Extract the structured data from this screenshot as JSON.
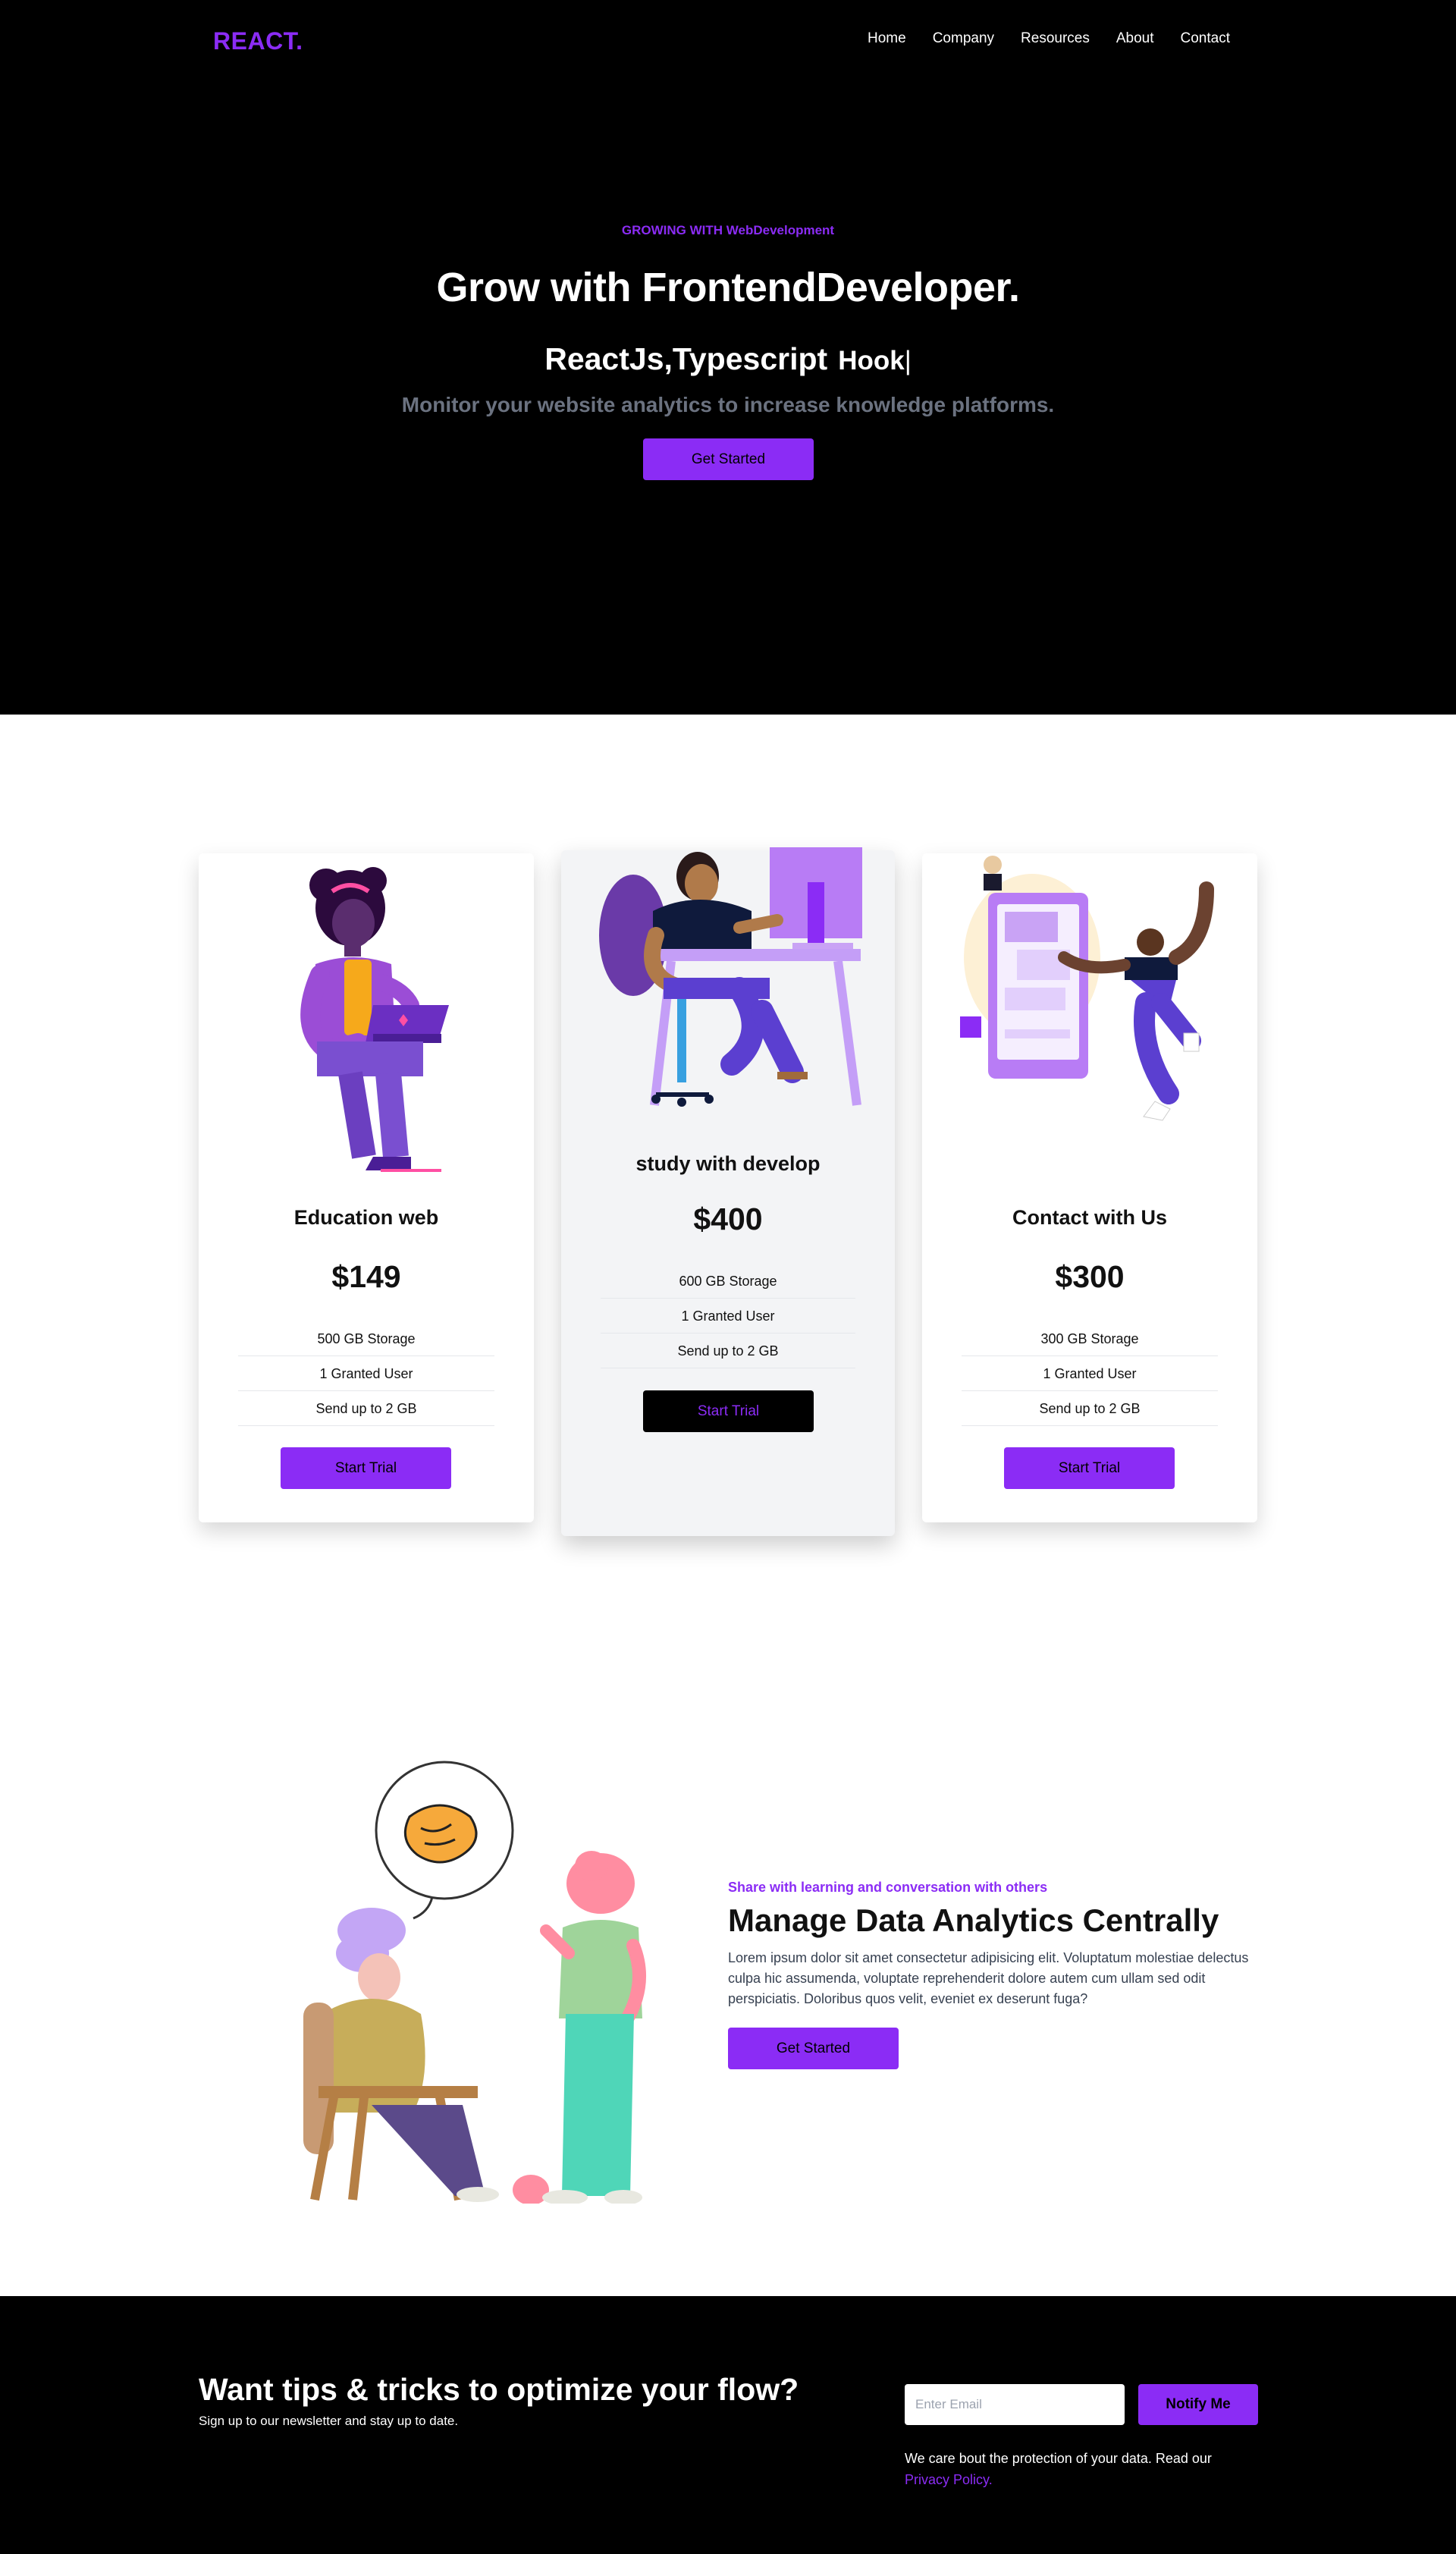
{
  "header": {
    "logo": "REACT.",
    "nav": [
      "Home",
      "Company",
      "Resources",
      "About",
      "Contact"
    ]
  },
  "hero": {
    "eyebrow": "GROWING WITH WebDevelopment",
    "title": "Grow with FrontendDeveloper.",
    "typed_static": "ReactJs,Typescript",
    "typed_word": "Hook",
    "cursor": "|",
    "subtitle": "Monitor your website analytics to increase knowledge platforms.",
    "cta": "Get Started"
  },
  "pricing": [
    {
      "name": "Education web",
      "price": "$149",
      "features": [
        "500 GB Storage",
        "1 Granted User",
        "Send up to 2 GB"
      ],
      "button": "Start Trial",
      "illustration": "woman-laptop-illustration"
    },
    {
      "name": "study with develop",
      "price": "$400",
      "features": [
        "600 GB Storage",
        "1 Granted User",
        "Send up to 2 GB"
      ],
      "button": "Start Trial",
      "illustration": "developer-desk-illustration"
    },
    {
      "name": "Contact with Us",
      "price": "$300",
      "features": [
        "300 GB Storage",
        "1 Granted User",
        "Send up to 2 GB"
      ],
      "button": "Start Trial",
      "illustration": "phone-chat-illustration"
    }
  ],
  "feature": {
    "eyebrow": "Share with learning and conversation with others",
    "title": "Manage Data Analytics Centrally",
    "body": "Lorem ipsum dolor sit amet consectetur adipisicing elit. Voluptatum molestiae delectus culpa hic assumenda, voluptate reprehenderit dolore autem cum ullam sed odit perspiciatis. Doloribus quos velit, eveniet ex deserunt fuga?",
    "cta": "Get Started",
    "illustration": "conversation-illustration"
  },
  "newsletter": {
    "title": "Want tips & tricks to optimize your flow?",
    "subtitle": "Sign up to our newsletter and stay up to date.",
    "input_placeholder": "Enter Email",
    "button": "Notify Me",
    "note": "We care bout the protection of your data. Read our",
    "link": "Privacy Policy."
  },
  "colors": {
    "accent": "#8b2cf5",
    "dark": "#000000",
    "muted": "#6b7280"
  }
}
